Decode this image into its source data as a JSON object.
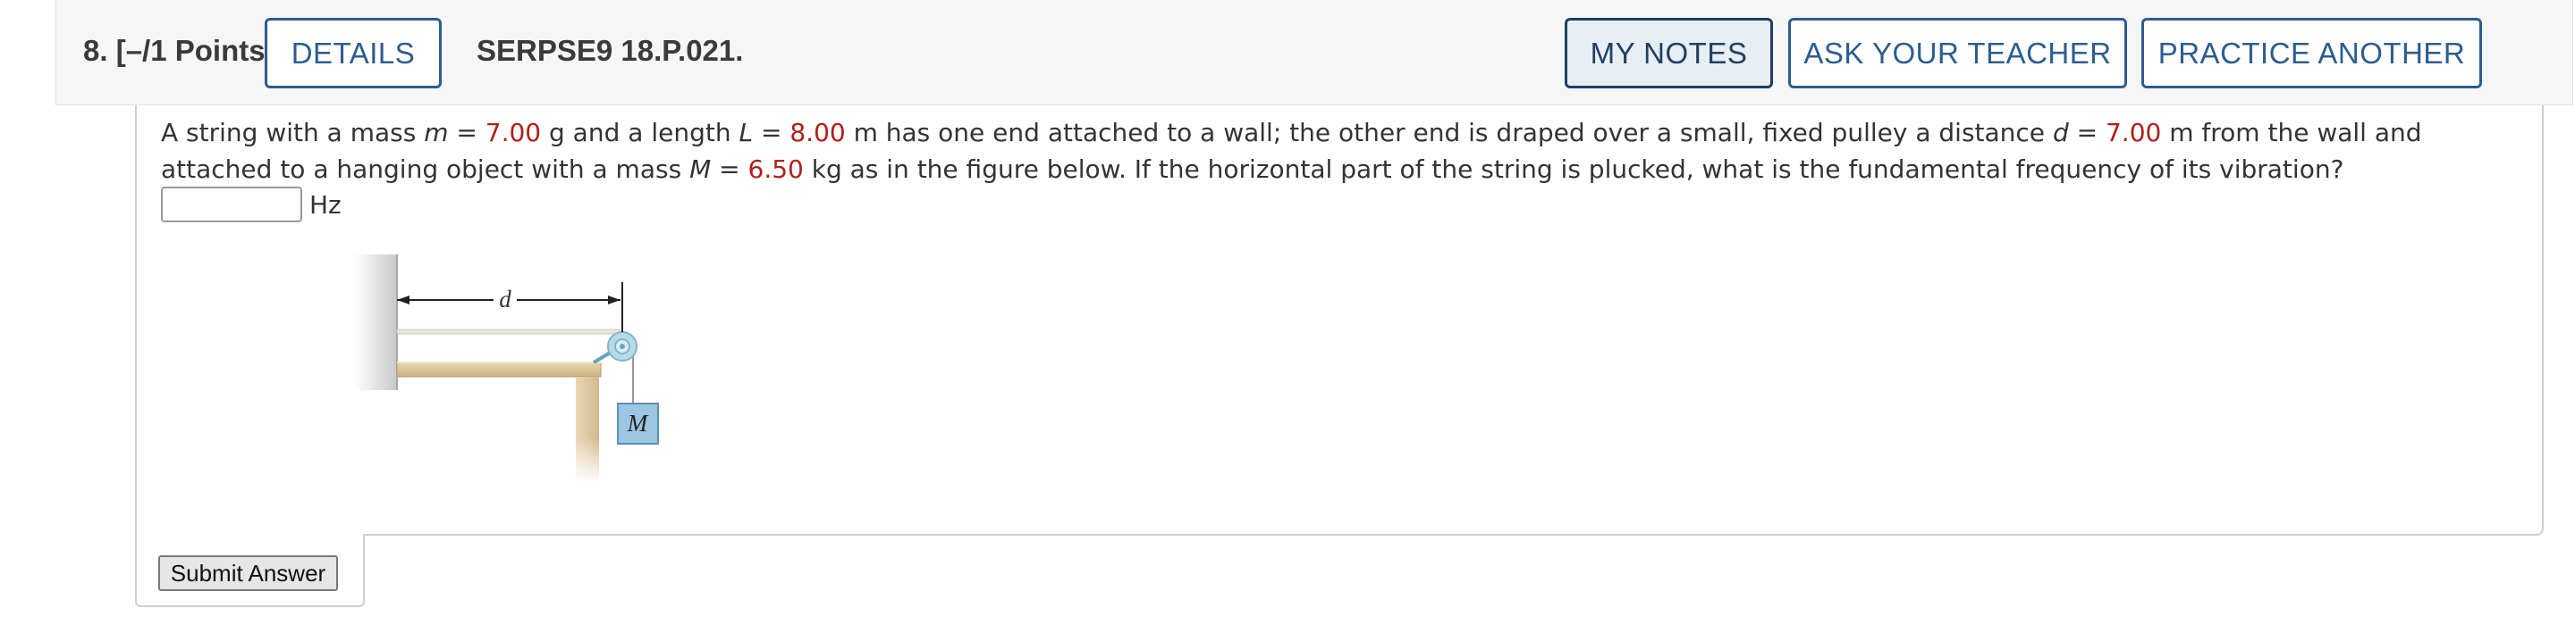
{
  "header": {
    "question_number": "8.",
    "points": "[–/1 Points]",
    "details_label": "DETAILS",
    "assignment_code": "SERPSE9 18.P.021.",
    "my_notes_label": "MY NOTES",
    "ask_teacher_label": "ASK YOUR TEACHER",
    "practice_label": "PRACTICE ANOTHER"
  },
  "question": {
    "t1": "A string with a mass ",
    "var_m": "m",
    "t2": " = ",
    "m_value": "7.00",
    "t3": " g and a length ",
    "var_L": "L",
    "t4": " = ",
    "L_value": "8.00",
    "t5": " m has one end attached to a wall; the other end is draped over a small, fixed pulley a distance ",
    "var_d": "d",
    "t6": " = ",
    "d_value": "7.00",
    "t7": " m from the wall and attached to a hanging object with a mass ",
    "var_M": "M",
    "t8": " = ",
    "M_value": "6.50",
    "t9": " kg as in the figure below. If the horizontal part of the string is plucked, what is the fundamental frequency of its vibration?"
  },
  "answer": {
    "value": "",
    "unit": "Hz"
  },
  "figure": {
    "d_label": "d",
    "mass_label": "M"
  },
  "submit_label": "Submit Answer",
  "colors": {
    "button_border": "#2c5d8f",
    "highlight_value": "#b0201a",
    "header_bg": "#f6f6f6"
  }
}
